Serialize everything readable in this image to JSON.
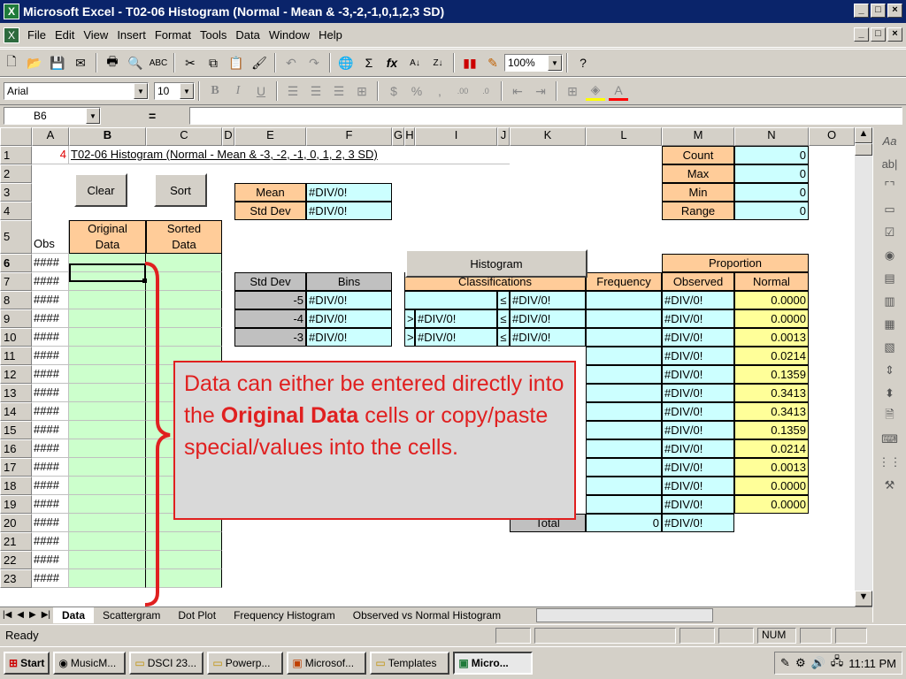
{
  "window": {
    "title": "Microsoft Excel - T02-06 Histogram (Normal - Mean & -3,-2,-1,0,1,2,3 SD)",
    "min": "_",
    "max": "□",
    "close": "×"
  },
  "menu": [
    "File",
    "Edit",
    "View",
    "Insert",
    "Format",
    "Tools",
    "Data",
    "Window",
    "Help"
  ],
  "toolbar": {
    "zoom": "100%",
    "font": "Arial",
    "size": "10"
  },
  "formula": {
    "namebox": "B6",
    "equals": "="
  },
  "columns": [
    "A",
    "B",
    "C",
    "D",
    "E",
    "F",
    "G",
    "H",
    "I",
    "J",
    "K",
    "L",
    "M",
    "N",
    "O"
  ],
  "rows": [
    "1",
    "2",
    "3",
    "4",
    "5",
    "6",
    "7",
    "8",
    "9",
    "10",
    "11",
    "12",
    "13",
    "14",
    "15",
    "16",
    "17",
    "18",
    "19",
    "20",
    "21",
    "22",
    "23"
  ],
  "sheet": {
    "a1": "4",
    "sheet_title": "T02-06 Histogram (Normal - Mean & -3, -2, -1, 0, 1, 2, 3 SD)",
    "clear_btn": "Clear",
    "sort_btn": "Sort",
    "histogram_btn": "Histogram",
    "mean_label": "Mean",
    "mean_val": "#DIV/0!",
    "sd_label": "Std Dev",
    "sd_val": "#DIV/0!",
    "obs": "Obs",
    "original1": "Original",
    "original2": "Data",
    "sorted1": "Sorted",
    "sorted2": "Data",
    "hash": "####",
    "stats": [
      [
        "Count",
        "0"
      ],
      [
        "Max",
        "0"
      ],
      [
        "Min",
        "0"
      ],
      [
        "Range",
        "0"
      ]
    ],
    "proportion": "Proportion",
    "hdr_stddev": "Std Dev",
    "hdr_bins": "Bins",
    "hdr_class": "Classifications",
    "hdr_freq": "Frequency",
    "hdr_obs": "Observed",
    "hdr_normal": "Normal",
    "bins_rows": [
      [
        "-5",
        "#DIV/0!"
      ],
      [
        "-4",
        "#DIV/0!"
      ],
      [
        "-3",
        "#DIV/0!"
      ]
    ],
    "class_rows": [
      [
        "",
        "≤",
        "#DIV/0!"
      ],
      [
        ">",
        "#DIV/0!",
        "≤",
        "#DIV/0!"
      ],
      [
        ">",
        "#DIV/0!",
        "≤",
        "#DIV/0!"
      ]
    ],
    "class_last": [
      ">",
      "#DIV/0!"
    ],
    "observed": [
      "#DIV/0!",
      "#DIV/0!",
      "#DIV/0!",
      "#DIV/0!",
      "#DIV/0!",
      "#DIV/0!",
      "#DIV/0!",
      "#DIV/0!",
      "#DIV/0!",
      "#DIV/0!",
      "#DIV/0!",
      "#DIV/0!"
    ],
    "normal": [
      "0.0000",
      "0.0000",
      "0.0013",
      "0.0214",
      "0.1359",
      "0.3413",
      "0.3413",
      "0.1359",
      "0.0214",
      "0.0013",
      "0.0000",
      "0.0000"
    ],
    "total_label": "Total",
    "total_freq": "0",
    "total_obs": "#DIV/0!"
  },
  "callout": {
    "pre": "Data can either be entered directly into the ",
    "bold": "Original Data",
    "post": " cells or copy/paste special/values into the cells."
  },
  "tabs": [
    "Data",
    "Scattergram",
    "Dot Plot",
    "Frequency Histogram",
    "Observed vs Normal Histogram"
  ],
  "status": {
    "ready": "Ready",
    "num": "NUM"
  },
  "taskbar": {
    "start": "Start",
    "items": [
      "MusicM...",
      "DSCI 23...",
      "Powerp...",
      "Microsof...",
      "Templates",
      "Micro..."
    ],
    "clock": "11:11 PM"
  }
}
